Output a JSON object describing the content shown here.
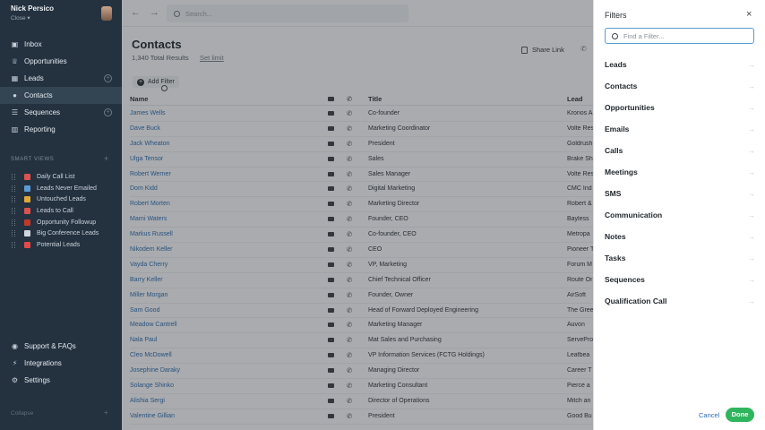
{
  "user": {
    "name": "Nick Persico",
    "org": "Close ▾"
  },
  "nav": [
    {
      "label": "Inbox",
      "icon": "inbox-icon",
      "glyph": "▣",
      "plus": false
    },
    {
      "label": "Opportunities",
      "icon": "trophy-icon",
      "glyph": "♕",
      "plus": false
    },
    {
      "label": "Leads",
      "icon": "building-icon",
      "glyph": "▦",
      "plus": true
    },
    {
      "label": "Contacts",
      "icon": "person-icon",
      "glyph": "●",
      "plus": false,
      "active": true
    },
    {
      "label": "Sequences",
      "icon": "list-icon",
      "glyph": "☰",
      "plus": true
    },
    {
      "label": "Reporting",
      "icon": "chart-icon",
      "glyph": "▥",
      "plus": false
    }
  ],
  "smart_views": {
    "title": "SMART VIEWS",
    "plus": "+",
    "items": [
      {
        "label": "Daily Call List",
        "color": "#d9534f"
      },
      {
        "label": "Leads Never Emailed",
        "color": "#5b9bd1"
      },
      {
        "label": "Untouched Leads",
        "color": "#e0a83a"
      },
      {
        "label": "Leads to Call",
        "color": "#d9534f"
      },
      {
        "label": "Opportunity Followup",
        "color": "#c0392b"
      },
      {
        "label": "Big Conference Leads",
        "color": "#cfd6dc"
      },
      {
        "label": "Potential Leads",
        "color": "#e24a4a"
      }
    ]
  },
  "bottom_nav": [
    {
      "label": "Support & FAQs",
      "icon": "help-icon",
      "glyph": "◉"
    },
    {
      "label": "Integrations",
      "icon": "plug-icon",
      "glyph": "⚡"
    },
    {
      "label": "Settings",
      "icon": "gear-icon",
      "glyph": "⚙"
    }
  ],
  "footer": {
    "left": "Collapse",
    "right": "+"
  },
  "topbar": {
    "back": "←",
    "forward": "→",
    "search_placeholder": "Search..."
  },
  "page": {
    "title": "Contacts",
    "total": "1,340 Total Results",
    "set_limit": "Set limit",
    "share_link": "Share Link",
    "add_filter": "Add Filter"
  },
  "table": {
    "headers": {
      "name": "Name",
      "title": "Title",
      "lead": "Lead"
    },
    "rows": [
      {
        "name": "James Wells",
        "title": "Co-founder",
        "lead": "Kronos A"
      },
      {
        "name": "Dave Buck",
        "title": "Marketing Coordinator",
        "lead": "Volte Res"
      },
      {
        "name": "Jack Wheaton",
        "title": "President",
        "lead": "Goldrush"
      },
      {
        "name": "Ulga Tensor",
        "title": "Sales",
        "lead": "Brake Sh"
      },
      {
        "name": "Robert Werner",
        "title": "Sales Manager",
        "lead": "Volte Res"
      },
      {
        "name": "Dom Kidd",
        "title": "Digital Marketing",
        "lead": "CMC Ind"
      },
      {
        "name": "Robert Morten",
        "title": "Marketing Director",
        "lead": "Robert &"
      },
      {
        "name": "Marni Waters",
        "title": "Founder, CEO",
        "lead": "Bayless"
      },
      {
        "name": "Markus Russell",
        "title": "Co-founder, CEO",
        "lead": "Metropa"
      },
      {
        "name": "Nikodem Keller",
        "title": "CEO",
        "lead": "Pioneer T"
      },
      {
        "name": "Vayda Cherry",
        "title": "VP, Marketing",
        "lead": "Forum M"
      },
      {
        "name": "Barry Keller",
        "title": "Chief Technical Officer",
        "lead": "Route Or"
      },
      {
        "name": "Miller Morgan",
        "title": "Founder, Owner",
        "lead": "AirSoft"
      },
      {
        "name": "Sam Good",
        "title": "Head of Forward Deployed Engineering",
        "lead": "The Gree"
      },
      {
        "name": "Meadow Cantrell",
        "title": "Marketing Manager",
        "lead": "Auvon"
      },
      {
        "name": "Nala Paul",
        "title": "Mat Sales and Purchasing",
        "lead": "ServePro"
      },
      {
        "name": "Cleo McDowell",
        "title": "VP Information Services (FCTG Holdings)",
        "lead": "Leafbea"
      },
      {
        "name": "Josephine Daraky",
        "title": "Managing Director",
        "lead": "Career T"
      },
      {
        "name": "Solange Shinko",
        "title": "Marketing Consultant",
        "lead": "Pierce a"
      },
      {
        "name": "Alishia Sergi",
        "title": "Director of Operations",
        "lead": "Mitch an"
      },
      {
        "name": "Valentine Gillian",
        "title": "President",
        "lead": "Good Bu"
      }
    ]
  },
  "filters": {
    "title": "Filters",
    "close": "×",
    "search_placeholder": "Find a Filter...",
    "items": [
      "Leads",
      "Contacts",
      "Opportunities",
      "Emails",
      "Calls",
      "Meetings",
      "SMS",
      "Communication",
      "Notes",
      "Tasks",
      "Sequences",
      "Qualification Call"
    ],
    "arrow": "→",
    "cancel": "Cancel",
    "done": "Done"
  }
}
